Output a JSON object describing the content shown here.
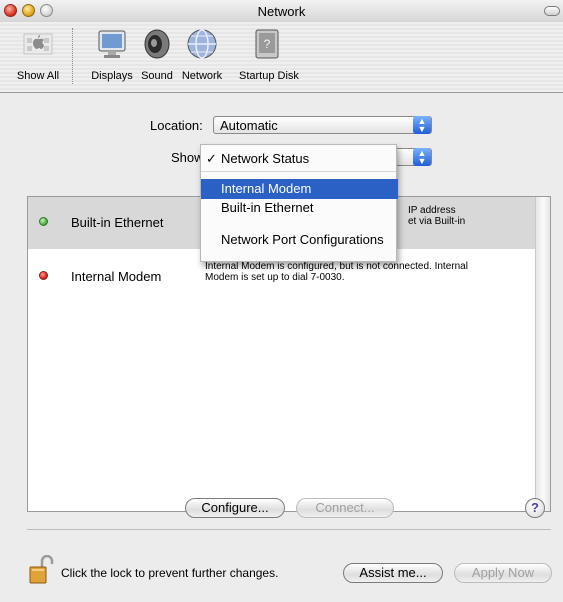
{
  "window": {
    "title": "Network"
  },
  "toolbar": {
    "items": [
      {
        "label": "Show All",
        "icon": "apple-grid-icon"
      },
      {
        "label": "Displays",
        "icon": "display-icon"
      },
      {
        "label": "Sound",
        "icon": "speaker-icon"
      },
      {
        "label": "Network",
        "icon": "globe-icon"
      },
      {
        "label": "Startup Disk",
        "icon": "hard-disk-icon"
      }
    ]
  },
  "location": {
    "label": "Location:",
    "value": "Automatic"
  },
  "show": {
    "label": "Show"
  },
  "show_menu": {
    "items": [
      {
        "label": "Network Status",
        "checked": true
      },
      {
        "label": "Internal Modem",
        "highlighted": true
      },
      {
        "label": "Built-in Ethernet"
      },
      {
        "label": "Network Port Configurations"
      }
    ],
    "check_mark": "✓"
  },
  "services": [
    {
      "name": "Built-in Ethernet",
      "status_color": "#3fa33a",
      "description_line1": "IP address",
      "description_line2": "et via Built-in"
    },
    {
      "name": "Internal Modem",
      "status_color": "#d8180c",
      "description_line1": "Internal Modem is configured, but is not connected. Internal",
      "description_line2": "Modem is set up to dial 7-0030."
    }
  ],
  "buttons": {
    "configure": "Configure...",
    "connect": "Connect...",
    "help": "?",
    "assist": "Assist me...",
    "apply": "Apply Now"
  },
  "lock": {
    "text": "Click the lock to prevent further changes."
  }
}
